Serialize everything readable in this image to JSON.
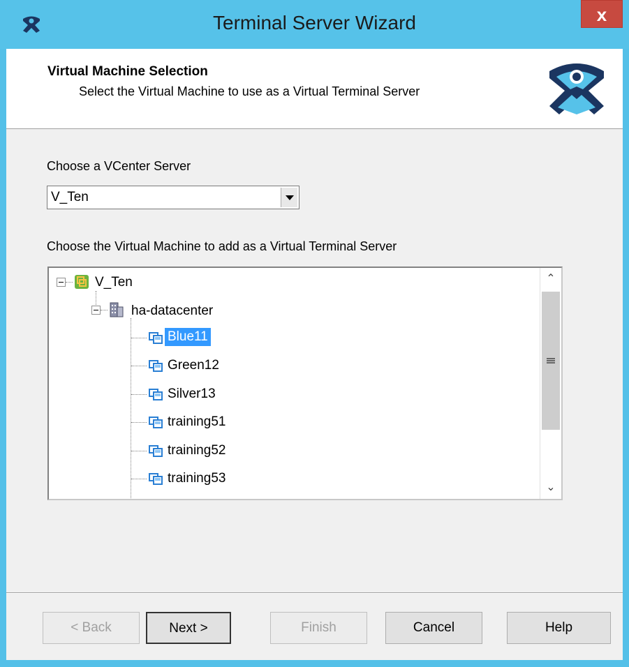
{
  "window": {
    "title": "Terminal Server Wizard",
    "close_label": "x"
  },
  "header": {
    "title": "Virtual Machine Selection",
    "subtitle": "Select the Virtual Machine to use as a Virtual Terminal Server"
  },
  "vcenter": {
    "label": "Choose a VCenter Server",
    "selected": "V_Ten"
  },
  "vm_tree": {
    "label": "Choose the Virtual Machine to add as a Virtual Terminal Server",
    "root": "V_Ten",
    "datacenter": "ha-datacenter",
    "vms": [
      "Blue11",
      "Green12",
      "Silver13",
      "training51",
      "training52",
      "training53"
    ],
    "selected_vm": "Blue11"
  },
  "buttons": {
    "back": "< Back",
    "next": "Next >",
    "finish": "Finish",
    "cancel": "Cancel",
    "help": "Help"
  },
  "colors": {
    "titlebar": "#56c2e9",
    "close": "#c74a40",
    "selection": "#3399ff"
  }
}
